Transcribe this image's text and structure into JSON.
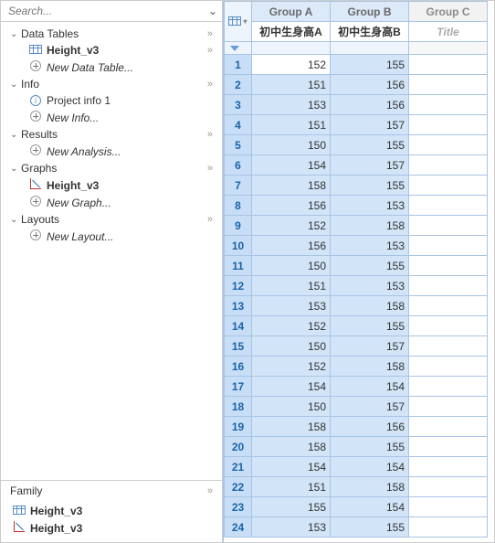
{
  "search": {
    "placeholder": "Search..."
  },
  "sections": {
    "dataTables": {
      "label": "Data Tables",
      "item": "Height_v3",
      "new": "New Data Table..."
    },
    "info": {
      "label": "Info",
      "item": "Project info 1",
      "new": "New Info..."
    },
    "results": {
      "label": "Results",
      "new": "New Analysis..."
    },
    "graphs": {
      "label": "Graphs",
      "item": "Height_v3",
      "new": "New Graph..."
    },
    "layouts": {
      "label": "Layouts",
      "new": "New Layout..."
    }
  },
  "family": {
    "label": "Family",
    "items": [
      "Height_v3",
      "Height_v3"
    ]
  },
  "grid": {
    "groupA": "Group A",
    "groupB": "Group B",
    "groupC": "Group C",
    "subA": "初中生身高A",
    "subB": "初中生身高B",
    "subC": "Title",
    "rows": [
      {
        "n": 1,
        "a": 152,
        "b": 155
      },
      {
        "n": 2,
        "a": 151,
        "b": 156
      },
      {
        "n": 3,
        "a": 153,
        "b": 156
      },
      {
        "n": 4,
        "a": 151,
        "b": 157
      },
      {
        "n": 5,
        "a": 150,
        "b": 155
      },
      {
        "n": 6,
        "a": 154,
        "b": 157
      },
      {
        "n": 7,
        "a": 158,
        "b": 155
      },
      {
        "n": 8,
        "a": 156,
        "b": 153
      },
      {
        "n": 9,
        "a": 152,
        "b": 158
      },
      {
        "n": 10,
        "a": 156,
        "b": 153
      },
      {
        "n": 11,
        "a": 150,
        "b": 155
      },
      {
        "n": 12,
        "a": 151,
        "b": 153
      },
      {
        "n": 13,
        "a": 153,
        "b": 158
      },
      {
        "n": 14,
        "a": 152,
        "b": 155
      },
      {
        "n": 15,
        "a": 150,
        "b": 157
      },
      {
        "n": 16,
        "a": 152,
        "b": 158
      },
      {
        "n": 17,
        "a": 154,
        "b": 154
      },
      {
        "n": 18,
        "a": 150,
        "b": 157
      },
      {
        "n": 19,
        "a": 158,
        "b": 156
      },
      {
        "n": 20,
        "a": 158,
        "b": 155
      },
      {
        "n": 21,
        "a": 154,
        "b": 154
      },
      {
        "n": 22,
        "a": 151,
        "b": 158
      },
      {
        "n": 23,
        "a": 155,
        "b": 154
      },
      {
        "n": 24,
        "a": 153,
        "b": 155
      }
    ]
  },
  "chart_data": {
    "type": "table",
    "columns": [
      "Group A 初中生身高A",
      "Group B 初中生身高B"
    ],
    "series": [
      {
        "name": "Group A",
        "values": [
          152,
          151,
          153,
          151,
          150,
          154,
          158,
          156,
          152,
          156,
          150,
          151,
          153,
          152,
          150,
          152,
          154,
          150,
          158,
          158,
          154,
          151,
          155,
          153
        ]
      },
      {
        "name": "Group B",
        "values": [
          155,
          156,
          156,
          157,
          155,
          157,
          155,
          153,
          158,
          153,
          155,
          153,
          158,
          155,
          157,
          158,
          154,
          157,
          156,
          155,
          154,
          158,
          154,
          155
        ]
      }
    ]
  }
}
